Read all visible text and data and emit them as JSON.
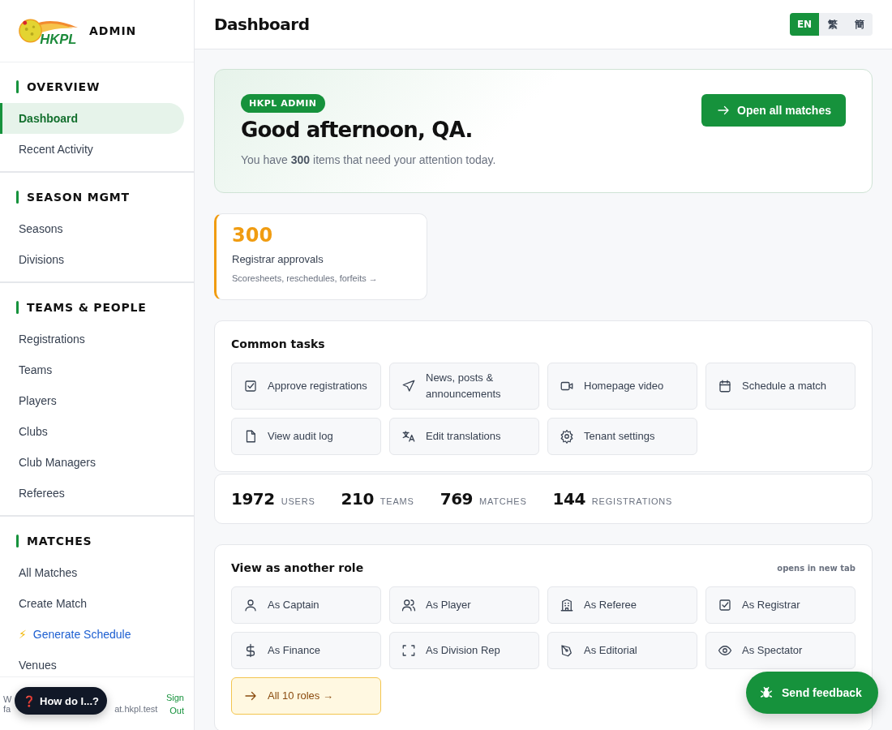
{
  "brand": {
    "logo_text": "HKPL",
    "title": "ADMIN"
  },
  "sidebar": {
    "sections": [
      {
        "title": "OVERVIEW",
        "items": [
          {
            "label": "Dashboard",
            "selected": true
          },
          {
            "label": "Recent Activity",
            "selected": false
          }
        ]
      },
      {
        "title": "SEASON MGMT",
        "items": [
          {
            "label": "Seasons",
            "selected": false
          },
          {
            "label": "Divisions",
            "selected": false
          }
        ]
      },
      {
        "title": "TEAMS & PEOPLE",
        "items": [
          {
            "label": "Registrations",
            "selected": false
          },
          {
            "label": "Teams",
            "selected": false
          },
          {
            "label": "Players",
            "selected": false
          },
          {
            "label": "Clubs",
            "selected": false
          },
          {
            "label": "Club Managers",
            "selected": false
          },
          {
            "label": "Referees",
            "selected": false
          }
        ]
      },
      {
        "title": "MATCHES",
        "items": [
          {
            "label": "All Matches",
            "selected": false
          },
          {
            "label": "Create Match",
            "selected": false
          },
          {
            "label": "Generate Schedule",
            "selected": false,
            "kind": "highlight",
            "icon_char": "⚡"
          },
          {
            "label": "Venues",
            "selected": false
          }
        ]
      }
    ],
    "user": {
      "name_start": "W",
      "email_start": "fa",
      "email_end": "at.hkpl.test",
      "sign_out": "Sign Out"
    }
  },
  "header": {
    "title": "Dashboard",
    "languages": [
      {
        "label": "EN",
        "selected": true
      },
      {
        "label": "繁",
        "selected": false
      },
      {
        "label": "簡",
        "selected": false
      }
    ]
  },
  "hero": {
    "badge": "HKPL ADMIN",
    "greeting": "Good afternoon, QA.",
    "message": "You have **300** items that need your attention today.",
    "button": "Open all matches"
  },
  "attention": [
    {
      "count": "300",
      "title": "Registrar approvals",
      "detail": "Scoresheets, reschedules, forfeits →"
    }
  ],
  "common_tasks": {
    "title": "Common tasks",
    "tasks": [
      {
        "label": "Approve registrations"
      },
      {
        "label": "News, posts & announcements"
      },
      {
        "label": "Homepage video"
      },
      {
        "label": "Schedule a match"
      },
      {
        "label": "View audit log"
      },
      {
        "label": "Edit translations"
      },
      {
        "label": "Tenant settings"
      }
    ]
  },
  "stats": [
    {
      "value": "1972",
      "label": "USERS"
    },
    {
      "value": "210",
      "label": "TEAMS"
    },
    {
      "value": "769",
      "label": "MATCHES"
    },
    {
      "value": "144",
      "label": "REGISTRATIONS"
    }
  ],
  "roles": {
    "title": "View as another role",
    "note": "opens in new tab",
    "items": [
      {
        "label": "As Captain",
        "kind": "role"
      },
      {
        "label": "As Player",
        "kind": "role"
      },
      {
        "label": "As Referee",
        "kind": "role"
      },
      {
        "label": "As Registrar",
        "kind": "role"
      },
      {
        "label": "As Finance",
        "kind": "role"
      },
      {
        "label": "As Division Rep",
        "kind": "role"
      },
      {
        "label": "As Editorial",
        "kind": "role"
      },
      {
        "label": "As Spectator",
        "kind": "role"
      },
      {
        "label": "All 10 roles →",
        "kind": "more"
      }
    ]
  },
  "help_button": {
    "icon_char": "❓",
    "label": "How do I...?"
  },
  "feedback_button": {
    "label": "Send feedback"
  }
}
